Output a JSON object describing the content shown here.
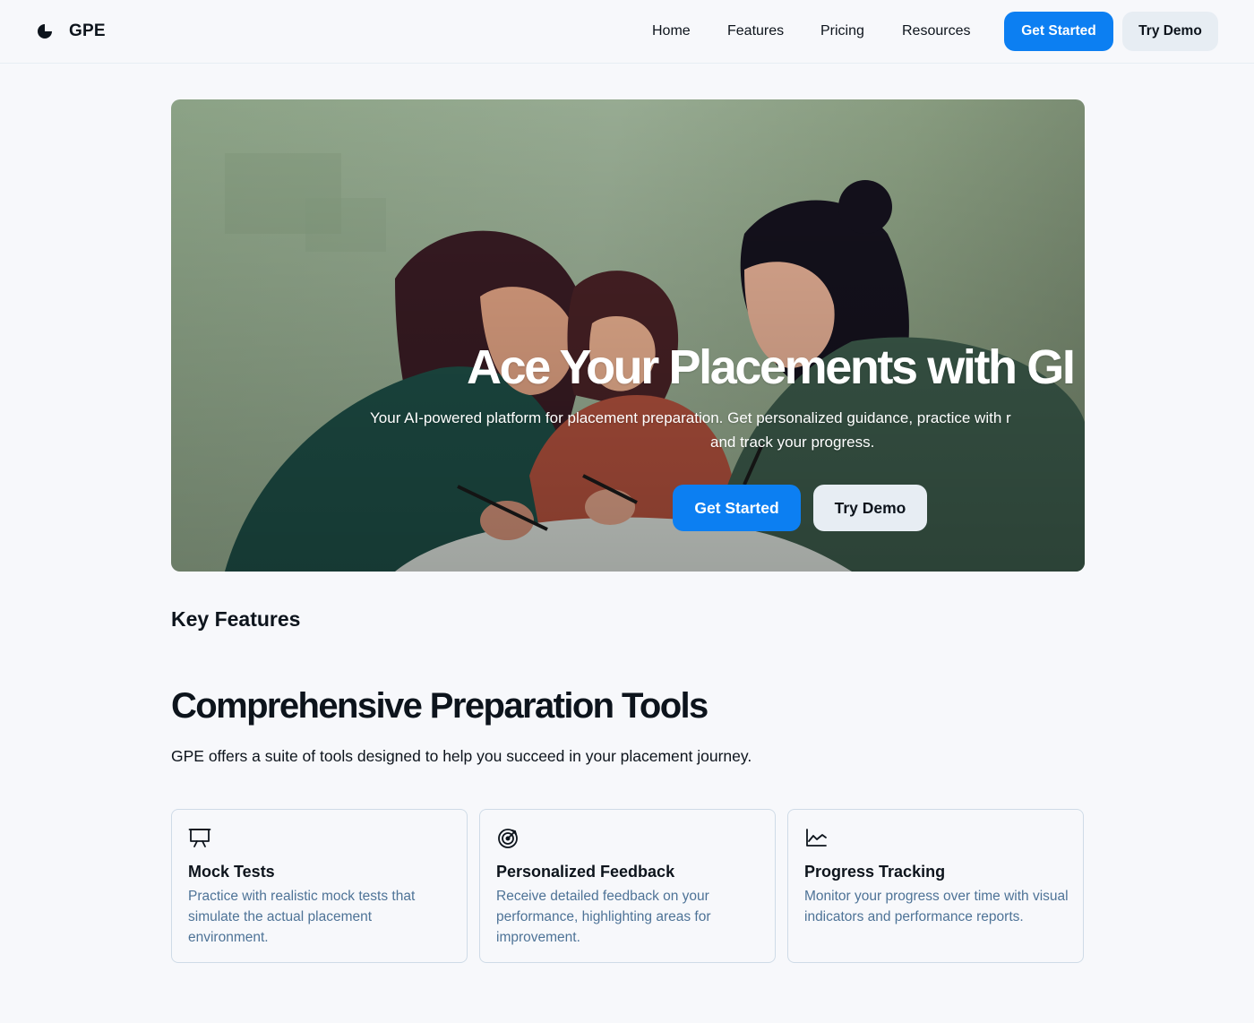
{
  "header": {
    "brand": "GPE",
    "nav": [
      "Home",
      "Features",
      "Pricing",
      "Resources"
    ],
    "get_started": "Get Started",
    "try_demo": "Try Demo"
  },
  "hero": {
    "title": "Ace Your Placements with GI",
    "subtitle_line1": "Your AI-powered platform for placement preparation. Get personalized guidance, practice with r",
    "subtitle_line2": "and track your progress.",
    "get_started": "Get Started",
    "try_demo": "Try Demo"
  },
  "features": {
    "heading": "Key Features",
    "title": "Comprehensive Preparation Tools",
    "subtitle": "GPE offers a suite of tools designed to help you succeed in your placement journey.",
    "cards": [
      {
        "icon": "presentation-board-icon",
        "title": "Mock Tests",
        "desc": "Practice with realistic mock tests that simulate the actual placement environment."
      },
      {
        "icon": "target-icon",
        "title": "Personalized Feedback",
        "desc": "Receive detailed feedback on your performance, highlighting areas for improvement."
      },
      {
        "icon": "line-chart-icon",
        "title": "Progress Tracking",
        "desc": "Monitor your progress over time with visual indicators and performance reports."
      }
    ]
  },
  "colors": {
    "primary": "#0c7ff2",
    "secondary_button": "#e7edf3",
    "card_text": "#4e7397",
    "background": "#f7f8fb"
  }
}
